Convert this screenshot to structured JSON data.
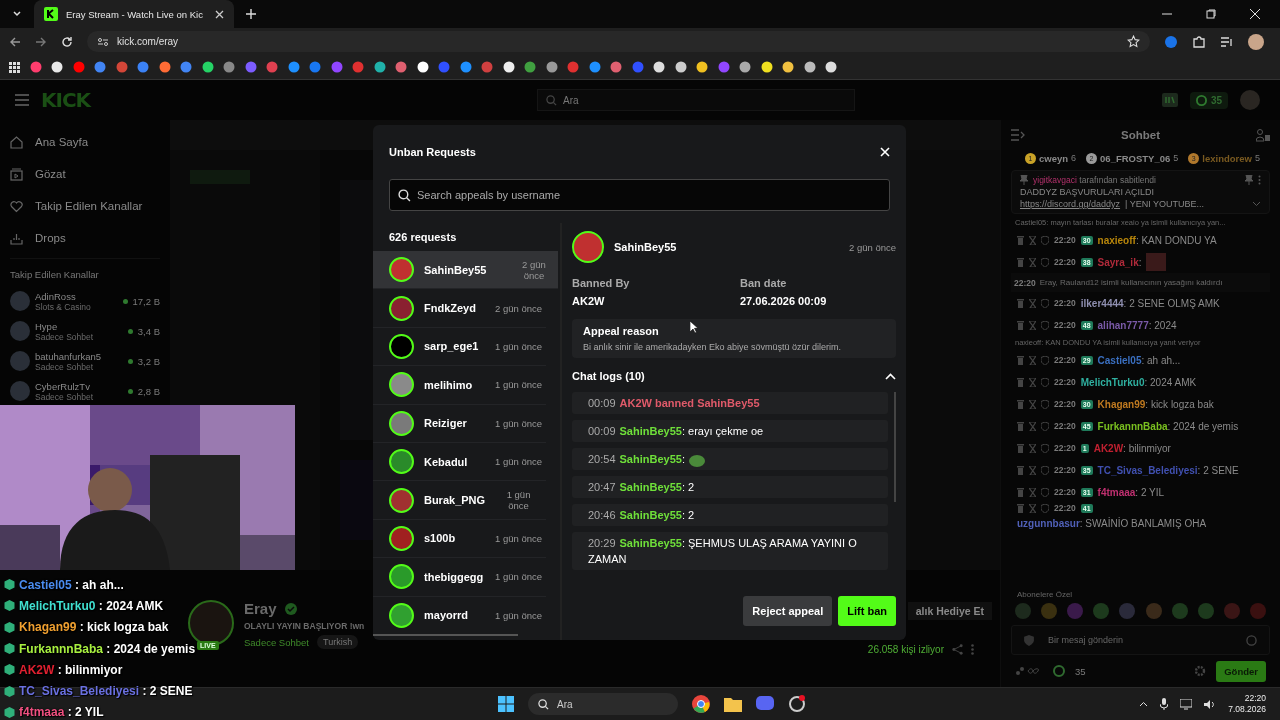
{
  "browser": {
    "tab_title": "Eray Stream - Watch Live on Kic",
    "url": "kick.com/eray"
  },
  "header": {
    "logo": "KICK",
    "search_placeholder": "Ara",
    "points": "35"
  },
  "sidebar": {
    "nav": [
      {
        "label": "Ana Sayfa",
        "kind": "home"
      },
      {
        "label": "Gözat",
        "kind": "browse"
      },
      {
        "label": "Takip Edilen Kanallar",
        "kind": "heart"
      },
      {
        "label": "Drops",
        "kind": "drops"
      }
    ],
    "section_title": "Takip Edilen Kanallar",
    "channels": [
      {
        "name": "AdinRoss",
        "category": "Slots & Casino",
        "viewers": "17,2 B"
      },
      {
        "name": "Hype",
        "category": "Sadece Sohbet",
        "viewers": "3,4 B"
      },
      {
        "name": "batuhanfurkan5",
        "category": "Sadece Sohbet",
        "viewers": "3,2 B"
      },
      {
        "name": "CyberRulzTv",
        "category": "Sadece Sohbet",
        "viewers": "2,8 B"
      }
    ]
  },
  "stream": {
    "name": "Eray",
    "title": "OLAYLI YAYIN BAŞLIYOR !wn",
    "live_badge": "LIVE",
    "category": "Sadece Sohbet",
    "tag": "Turkish",
    "viewers": "26.058 kişi izliyor",
    "gift_button": "alık Hediye Et"
  },
  "modal": {
    "title": "Unban Requests",
    "search_placeholder": "Search appeals by username",
    "count": "626 requests",
    "requests": [
      {
        "name": "SahinBey55",
        "time": "2 gün önce",
        "selected": true
      },
      {
        "name": "FndkZeyd",
        "time": "2 gün önce",
        "selected": false
      },
      {
        "name": "sarp_ege1",
        "time": "1 gün önce",
        "selected": false
      },
      {
        "name": "melihimo",
        "time": "1 gün önce",
        "selected": false
      },
      {
        "name": "Reiziger",
        "time": "1 gün önce",
        "selected": false
      },
      {
        "name": "Kebadul",
        "time": "1 gün önce",
        "selected": false
      },
      {
        "name": "Burak_PNG",
        "time": "1 gün önce",
        "selected": false
      },
      {
        "name": "s100b",
        "time": "1 gün önce",
        "selected": false
      },
      {
        "name": "thebiggegg",
        "time": "1 gün önce",
        "selected": false
      },
      {
        "name": "mayorrd",
        "time": "1 gün önce",
        "selected": false
      }
    ],
    "detail": {
      "user": "SahinBey55",
      "time": "2 gün önce",
      "banned_by_label": "Banned By",
      "banned_by": "AK2W",
      "ban_date_label": "Ban date",
      "ban_date": "27.06.2026 00:09",
      "appeal_title": "Appeal reason",
      "appeal_text": "Bi anlık sinir ile amerikadayken Eko abiye sövmüştü özür dilerim.",
      "chat_logs_title": "Chat logs (10)",
      "chat_logs_expanded": true,
      "logs": [
        {
          "time": "00:09",
          "kind": "ban",
          "text": "AK2W banned SahinBey55"
        },
        {
          "time": "00:09",
          "kind": "message",
          "user": "SahinBey55",
          "text": ": erayı çekme oe"
        },
        {
          "time": "20:54",
          "kind": "emote",
          "user": "SahinBey55",
          "text": ":"
        },
        {
          "time": "20:47",
          "kind": "message",
          "user": "SahinBey55",
          "text": ": 2"
        },
        {
          "time": "20:46",
          "kind": "message",
          "user": "SahinBey55",
          "text": ": 2"
        },
        {
          "time": "20:29",
          "kind": "message",
          "user": "SahinBey55",
          "text": ": ŞEHMUS ULAŞ ARAMA YAYINI O ZAMAN"
        }
      ]
    },
    "buttons": [
      {
        "label": "Reject appeal",
        "kind": "secondary"
      },
      {
        "label": "Lift ban",
        "kind": "primary"
      }
    ]
  },
  "chat": {
    "title": "Sohbet",
    "gifters": [
      {
        "rank": "1",
        "name": "cweyn",
        "count": "6",
        "color": "#c9a227"
      },
      {
        "rank": "2",
        "name": "06_FROSTY_06",
        "count": "5",
        "color": "#9a9a9a"
      },
      {
        "rank": "3",
        "name": "lexindorew",
        "count": "5",
        "color": "#b0782c"
      }
    ],
    "pinned": {
      "pinned_by": "yigitkavgaci",
      "suffix": "tarafından sabitlendi",
      "message": "DADDYZ BAŞVURULARI AÇILDI",
      "link": "https://discord.gg/daddyz",
      "rest": "| YENI YOUTUBE..."
    },
    "messages": [
      {
        "kind": "reply",
        "text": "Castiel05: mayın tarlası buralar xeaio ya isimli kullanıcıya yan..."
      },
      {
        "kind": "message",
        "time": "22:20",
        "badge": "30",
        "user": "naxieoff",
        "color": "#b8860b",
        "text": ": KAN DONDU YA"
      },
      {
        "kind": "emote",
        "time": "22:20",
        "badge": "38",
        "user": "Sayra_ik",
        "color": "#b02a3a",
        "text": ":"
      },
      {
        "kind": "system",
        "time": "22:20",
        "text": "Eray, Rauland12 isimli kullanıcının yasağını kaldırdı"
      },
      {
        "kind": "message",
        "time": "22:20",
        "user": "ilker4444",
        "color": "#8f8fb0",
        "text": ": 2 SENE OLMŞ AMK"
      },
      {
        "kind": "message",
        "time": "22:20",
        "badge": "48",
        "user": "alihan7777",
        "color": "#7a5aa8",
        "text": ": 2024"
      },
      {
        "kind": "reply",
        "text": "naxieoff: KAN DONDU YA isimli kullanıcıya yanıt veriyor"
      },
      {
        "kind": "message",
        "time": "22:20",
        "badge": "29",
        "user": "Castiel05",
        "color": "#3a6fc0",
        "text": ": ah ah..."
      },
      {
        "kind": "message",
        "time": "22:20",
        "user": "MelichTurku0",
        "color": "#2fb0a0",
        "text": ": 2024 AMK"
      },
      {
        "kind": "message",
        "time": "22:20",
        "badge": "30",
        "user": "Khagan99",
        "color": "#c07a20",
        "text": ": kick logza bak"
      },
      {
        "kind": "message",
        "time": "22:20",
        "badge": "45",
        "user": "FurkannnBaba",
        "color": "#7ac020",
        "text": ": 2024 de yemis"
      },
      {
        "kind": "message",
        "time": "22:20",
        "badge": "1",
        "user": "AK2W",
        "color": "#c02030",
        "text": ": bilinmiyor"
      },
      {
        "kind": "message",
        "time": "22:20",
        "badge": "35",
        "user": "TC_Sivas_Belediyesi",
        "color": "#4050b0",
        "text": ": 2 SENE"
      },
      {
        "kind": "message",
        "time": "22:20",
        "badge": "31",
        "user": "f4tmaaa",
        "color": "#c03070",
        "text": ": 2 YIL"
      },
      {
        "kind": "message",
        "time": "22:20",
        "badge": "41",
        "user": "uzgunnbasur",
        "color": "#5060b8",
        "text": ": SWAİNİO BANLAMIŞ OHA"
      }
    ],
    "emote_section": "Abonelere Özel",
    "input_placeholder": "Bir mesaj gönderin",
    "points": "35",
    "send_button": "Gönder"
  },
  "overlay_chat": [
    {
      "user": "Castiel05",
      "color": "#4a8cf0",
      "text": ": ah ah..."
    },
    {
      "user": "MelichTurku0",
      "color": "#40e0d0",
      "text": ": 2024 AMK"
    },
    {
      "user": "Khagan99",
      "color": "#f0a030",
      "text": ": kick logza bak"
    },
    {
      "user": "FurkannnBaba",
      "color": "#a8f040",
      "text": ": 2024 de yemis"
    },
    {
      "user": "AK2W",
      "color": "#e02030",
      "text": ": bilinmiyor"
    },
    {
      "user": "TC_Sivas_Belediyesi",
      "color": "#6a70e0",
      "text": ": 2 SENE"
    },
    {
      "user": "f4tmaaa",
      "color": "#f05080",
      "text": ": 2 YIL"
    }
  ],
  "taskbar": {
    "search_placeholder": "Ara",
    "time": "22:20",
    "date": "7.08.2026"
  }
}
